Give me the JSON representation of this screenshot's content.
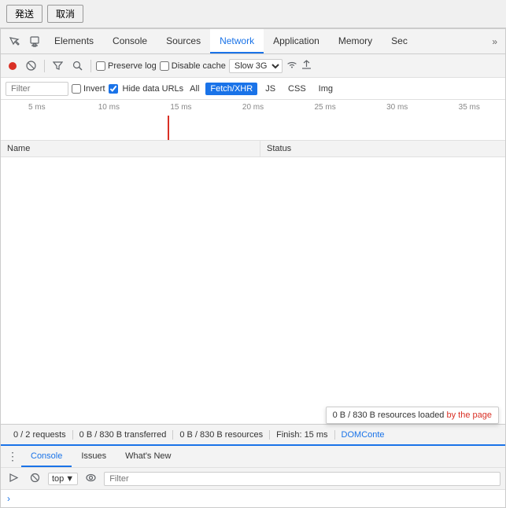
{
  "top_buttons": {
    "submit": "発送",
    "cancel": "取消"
  },
  "tabs": [
    {
      "id": "elements",
      "label": "Elements",
      "active": false
    },
    {
      "id": "console",
      "label": "Console",
      "active": false
    },
    {
      "id": "sources",
      "label": "Sources",
      "active": false
    },
    {
      "id": "network",
      "label": "Network",
      "active": true
    },
    {
      "id": "application",
      "label": "Application",
      "active": false
    },
    {
      "id": "memory",
      "label": "Memory",
      "active": false
    },
    {
      "id": "security",
      "label": "Sec",
      "active": false
    }
  ],
  "toolbar": {
    "preserve_log": "Preserve log",
    "disable_cache": "Disable cache",
    "throttle": "Slow 3G"
  },
  "filter_bar": {
    "filter_placeholder": "Filter",
    "invert_label": "Invert",
    "hide_data_label": "Hide data URLs",
    "all_label": "All",
    "type_buttons": [
      "Fetch/XHR",
      "JS",
      "CSS",
      "Img"
    ]
  },
  "timeline": {
    "ticks": [
      "5 ms",
      "10 ms",
      "15 ms",
      "20 ms",
      "25 ms",
      "30 ms",
      "35 ms"
    ]
  },
  "table": {
    "col_name": "Name",
    "col_status": "Status"
  },
  "status_bar": {
    "requests": "0 / 2 requests",
    "transferred": "0 B / 830 B transferred",
    "resources": "0 B / 830 B resources",
    "finish": "Finish: 15 ms",
    "dom_content": "DOMConte",
    "tooltip": "0 B / 830 B resources loaded by the page"
  },
  "bottom_drawer": {
    "tabs": [
      "Console",
      "Issues",
      "What's New"
    ],
    "active_tab": "Console",
    "top_value": "top",
    "filter_placeholder": "Filter"
  },
  "colors": {
    "active_tab": "#1a73e8",
    "record_red": "#d93025",
    "tooltip_red": "#d93025"
  }
}
